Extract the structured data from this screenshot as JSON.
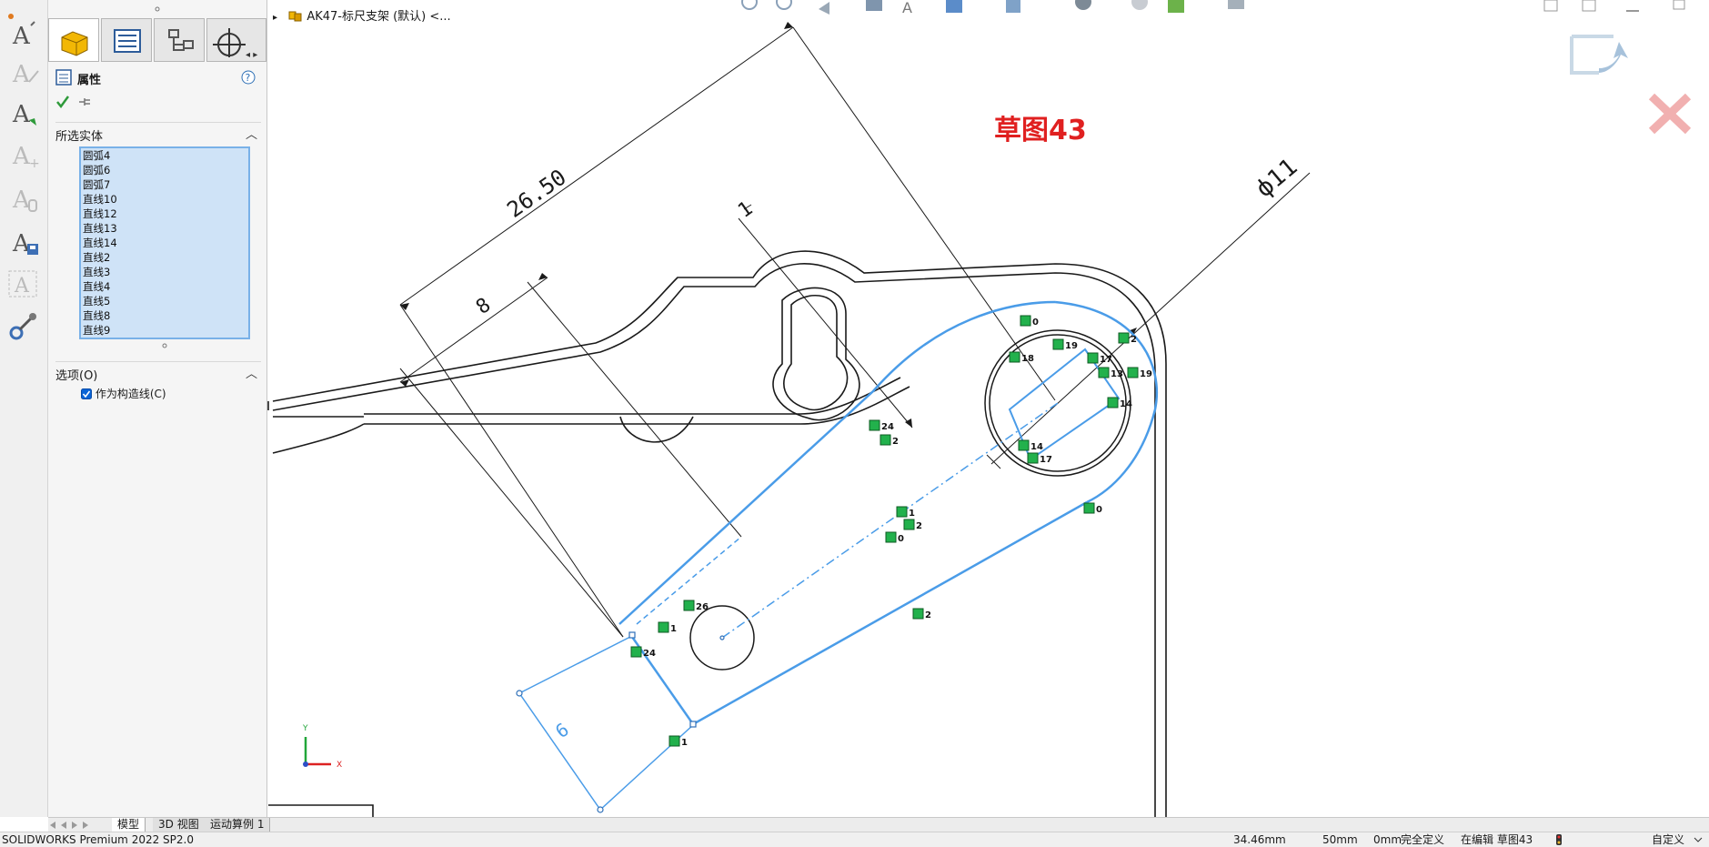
{
  "document": {
    "title": "AK47-标尺支架 (默认) <..."
  },
  "sketch": {
    "name": "草图43"
  },
  "dimensions": {
    "d1": "26.50",
    "d2": "8",
    "d3": "1",
    "d4": "ϕ11",
    "d5": "6"
  },
  "property_manager": {
    "title": "属性",
    "selected_section": "所选实体",
    "entities": [
      "圆弧4",
      "圆弧6",
      "圆弧7",
      "直线10",
      "直线12",
      "直线13",
      "直线14",
      "直线2",
      "直线3",
      "直线4",
      "直线5",
      "直线8",
      "直线9"
    ],
    "options_section": "选项(O)",
    "construction_label": "作为构造线(C)",
    "construction_checked": true
  },
  "relations": [
    {
      "label": "0"
    },
    {
      "label": "18"
    },
    {
      "label": "19"
    },
    {
      "label": "2"
    },
    {
      "label": "17"
    },
    {
      "label": "13"
    },
    {
      "label": "19"
    },
    {
      "label": "14"
    },
    {
      "label": "14"
    },
    {
      "label": "17"
    },
    {
      "label": "24"
    },
    {
      "label": "2"
    },
    {
      "label": "1"
    },
    {
      "label": "2"
    },
    {
      "label": "0"
    },
    {
      "label": "0"
    },
    {
      "label": "26"
    },
    {
      "label": "1"
    },
    {
      "label": "24"
    },
    {
      "label": "2"
    },
    {
      "label": "1"
    }
  ],
  "bottom_tabs": [
    "模型",
    "3D 视图",
    "运动算例 1"
  ],
  "status": {
    "product": "SOLIDWORKS Premium 2022 SP2.0",
    "x": "34.46mm",
    "y": "50mm",
    "z": "0mm",
    "state": "完全定义",
    "editing": "在编辑 草图43",
    "units": "自定义"
  },
  "colors": {
    "sketch_blue": "#4a9ce8",
    "sketch_title_red": "#e02020",
    "relation_green": "#22b14c"
  },
  "icons": [
    "text-icon",
    "text-edit-icon",
    "text-import-icon",
    "text-add-icon",
    "text-link-icon",
    "text-save-icon",
    "text-frame-icon",
    "tools-icon"
  ]
}
